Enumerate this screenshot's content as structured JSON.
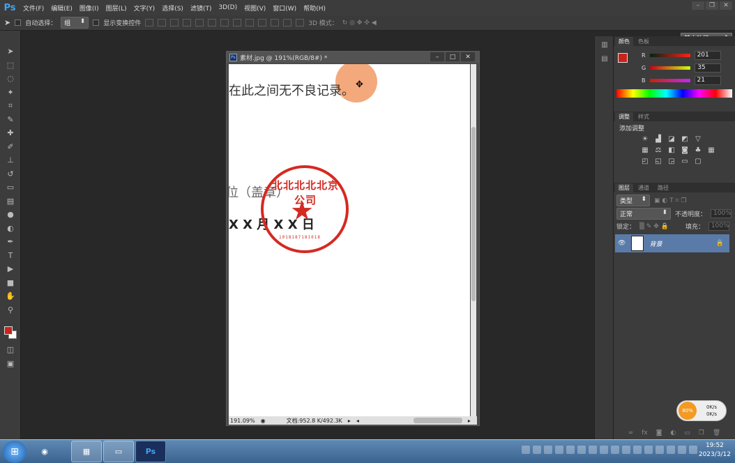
{
  "app": {
    "logo": "Ps"
  },
  "menu": [
    "文件(F)",
    "编辑(E)",
    "图像(I)",
    "图层(L)",
    "文字(Y)",
    "选择(S)",
    "滤镜(T)",
    "3D(D)",
    "视图(V)",
    "窗口(W)",
    "帮助(H)"
  ],
  "options": {
    "auto_select_label": "自动选择：",
    "auto_select_value": "组",
    "show_transform_label": "显示变换控件",
    "mode3d_label": "3D 模式：",
    "workspace": "基本功能"
  },
  "document": {
    "title": "素材.jpg @ 191%(RGB/8#) *",
    "zoom": "191.09%",
    "doc_size": "文档:952.8 K/492.3K",
    "canvas_lines": [
      "在此之间无不良记录。",
      "位（盖章）",
      "X X 月 X X 日"
    ],
    "stamp_text": "北北北北北京公司",
    "stamp_number": "1018187181018"
  },
  "color_panel": {
    "tabs": [
      "颜色",
      "色板"
    ],
    "channels": [
      {
        "label": "R",
        "value": "201",
        "color": "#c9231a"
      },
      {
        "label": "G",
        "value": "35",
        "color": "#23c91a"
      },
      {
        "label": "B",
        "value": "21",
        "color": "#1a23c9"
      }
    ]
  },
  "adjust_panel": {
    "tabs": [
      "调整",
      "样式"
    ],
    "title": "添加调整"
  },
  "layers_panel": {
    "tabs": [
      "图层",
      "通道",
      "路径"
    ],
    "filter": "类型",
    "blend_mode": "正常",
    "opacity_label": "不透明度：",
    "opacity_value": "100%",
    "lock_label": "锁定：",
    "fill_label": "填充：",
    "fill_value": "100%",
    "layer_name": "背景"
  },
  "speed_widget": {
    "percent": "80%",
    "up": "0K/s",
    "down": "0K/s"
  },
  "taskbar": {
    "time": "19:52",
    "date": "2023/3/12",
    "ps_label": "Ps"
  }
}
